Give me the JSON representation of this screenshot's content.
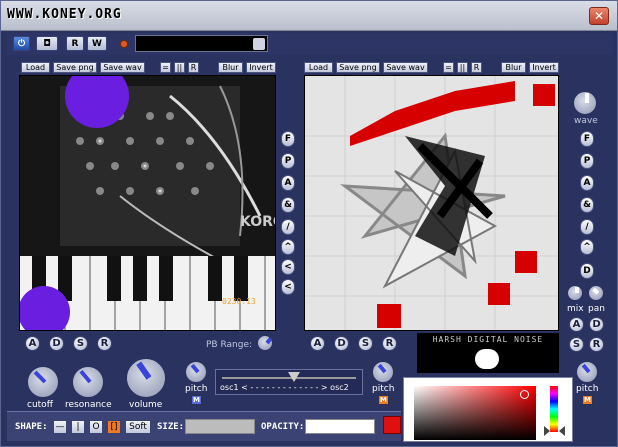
{
  "window": {
    "title": "WWW.KONEY.ORG",
    "close_glyph": "✕"
  },
  "toolbar": {
    "power_glyph": "⏻",
    "stop_glyph": "◘",
    "r_label": "R",
    "w_label": "W"
  },
  "left_panel": {
    "buttons": [
      "Load",
      "Save png",
      "Save wav",
      "=",
      "||",
      "R",
      "Blur",
      "Invert"
    ],
    "side_buttons": [
      "F",
      "P",
      "A",
      "&",
      "/",
      "^",
      "<",
      "<"
    ],
    "adsr": [
      "A",
      "D",
      "S",
      "R"
    ]
  },
  "right_panel": {
    "buttons": [
      "Load",
      "Save png",
      "Save wav",
      "=",
      "||",
      "R",
      "Blur",
      "Invert"
    ],
    "side_buttons": [
      "F",
      "P",
      "A",
      "&",
      "/",
      "^",
      "D"
    ],
    "wave_label": "wave",
    "mix_label": "mix",
    "pan_label": "pan",
    "adsr": [
      "A",
      "D",
      "S",
      "R"
    ],
    "side_adsr": [
      "A",
      "D",
      "S",
      "R"
    ]
  },
  "controls": {
    "pb_range_label": "PB Range:",
    "cutoff_label": "cutoff",
    "resonance_label": "resonance",
    "volume_label": "volume",
    "pitch_label": "pitch",
    "m_label": "M",
    "osc_label": "osc1 < - - - - - - - - - - - - - > osc2",
    "pitch2_label": "pitch",
    "pitch3_label": "pitch"
  },
  "logo": {
    "text": "HARSH DIGITAL NOISE"
  },
  "bottom": {
    "shape_label": "SHAPE:",
    "shape_buttons": [
      "—",
      "|",
      "O",
      "[]",
      "Soft"
    ],
    "size_label": "SIZE:",
    "opacity_label": "OPACITY:"
  },
  "colors": {
    "accent_red": "#e01010",
    "violet": "#6a1fe0",
    "brand_bg": "#2a3360"
  },
  "icons": {
    "close": "close-icon",
    "power": "power-icon",
    "stop": "stop-icon",
    "record": "record-icon"
  }
}
